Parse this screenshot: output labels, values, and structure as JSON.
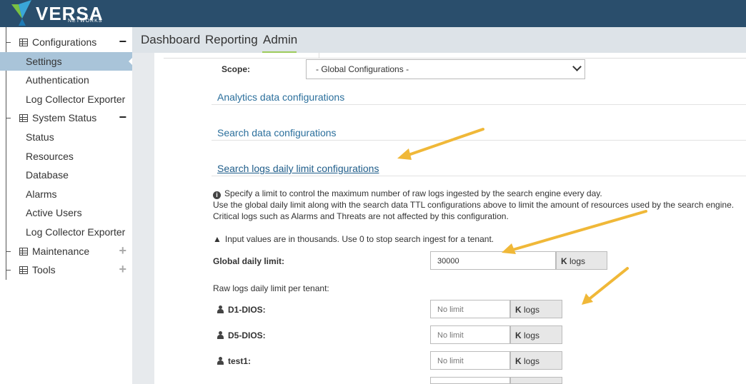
{
  "brand": {
    "name": "VERSA",
    "sub": "NETWORKS"
  },
  "nav": {
    "items": [
      "Dashboard",
      "Reporting",
      "Admin"
    ],
    "active": "Admin"
  },
  "sidebar": {
    "groups": [
      {
        "label": "Configurations",
        "toggle": "−",
        "children": [
          "Settings",
          "Authentication",
          "Log Collector Exporter"
        ]
      },
      {
        "label": "System Status",
        "toggle": "−",
        "children": [
          "Status",
          "Resources",
          "Database",
          "Alarms",
          "Active Users",
          "Log Collector Exporter"
        ]
      },
      {
        "label": "Maintenance",
        "toggle": "+"
      },
      {
        "label": "Tools",
        "toggle": "+"
      }
    ],
    "active": "Settings"
  },
  "scope": {
    "label": "Scope:",
    "value": "- Global Configurations -"
  },
  "sections": [
    "Analytics data configurations",
    "Search data configurations",
    "Search logs daily limit configurations"
  ],
  "info": {
    "line1": "Specify a limit to control the maximum number of raw logs ingested by the search engine every day.",
    "line2": "Use the global daily limit along with the search data TTL configurations above to limit the amount of resources used by the search engine.",
    "line3": "Critical logs such as Alarms and Threats are not affected by this configuration.",
    "warning": "Input values are in thousands. Use 0 to stop search ingest for a tenant."
  },
  "global_limit": {
    "label": "Global daily limit:",
    "value": "30000",
    "unit_k": "K",
    "unit": "logs"
  },
  "per_tenant_label": "Raw logs daily limit per tenant:",
  "tenants": [
    {
      "name": "D1-DIOS:",
      "placeholder": "No limit"
    },
    {
      "name": "D5-DIOS:",
      "placeholder": "No limit"
    },
    {
      "name": "test1:",
      "placeholder": "No limit"
    }
  ],
  "unit_k": "K",
  "unit": "logs",
  "colors": {
    "header": "#2a4e6c",
    "active_side": "#a9c4d9",
    "accent": "#9ccb5b",
    "link": "#2b6f9c",
    "annotation_arrow": "#f0b838"
  }
}
